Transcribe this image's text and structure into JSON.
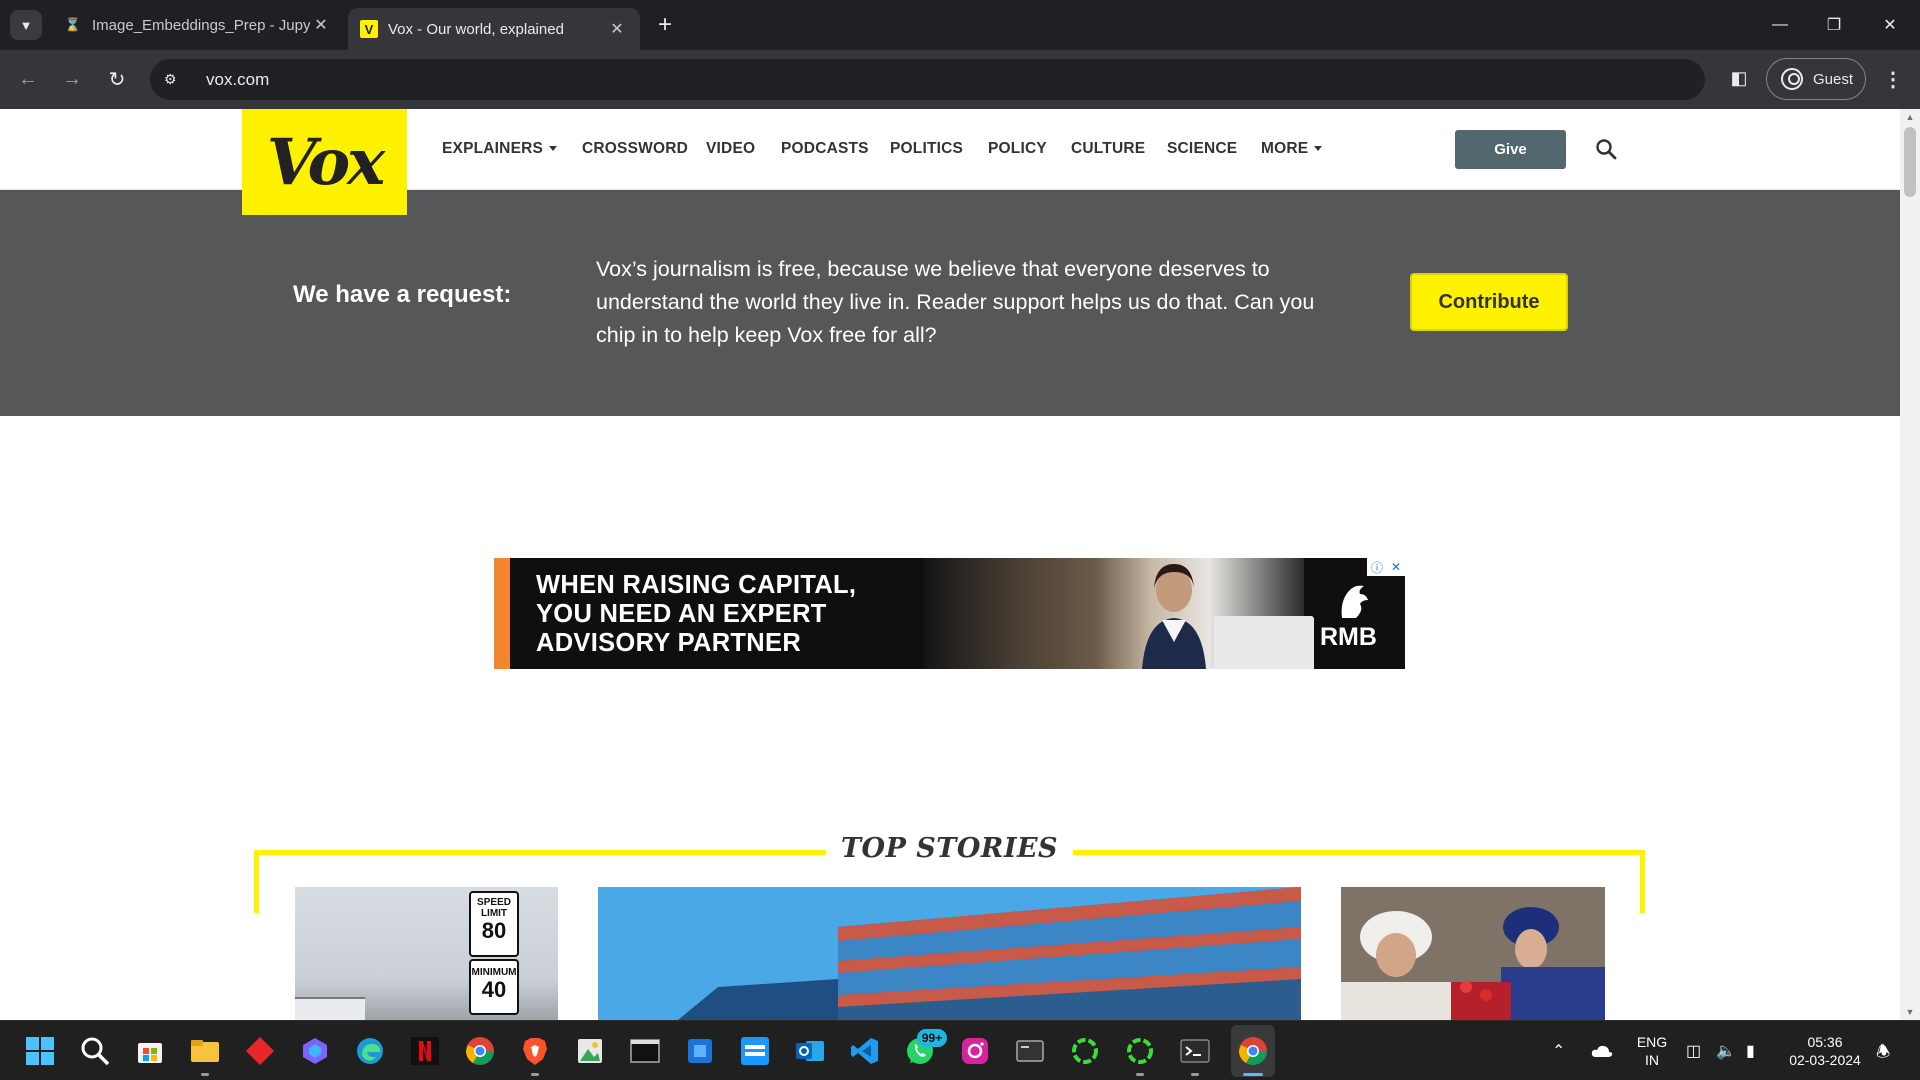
{
  "browser": {
    "tabs": [
      {
        "title": "Image_Embeddings_Prep - Jupyter",
        "favicon": "hourglass-icon"
      },
      {
        "title": "Vox - Our world, explained",
        "favicon": "vox-favicon",
        "active": true
      }
    ],
    "favicon_vox_letter": "V",
    "url": "vox.com",
    "profile_label": "Guest"
  },
  "vox": {
    "logo": "Vox",
    "nav": [
      "EXPLAINERS",
      "CROSSWORD",
      "VIDEO",
      "PODCASTS",
      "POLITICS",
      "POLICY",
      "CULTURE",
      "SCIENCE",
      "MORE"
    ],
    "give_label": "Give",
    "request_heading": "We have a request:",
    "request_body": "Vox’s journalism is free, because we believe that everyone deserves to understand the world they live in. Reader support helps us do that. Can you chip in to help keep Vox free for all?",
    "contribute_label": "Contribute",
    "top_stories_title": "TOP STORIES"
  },
  "ad": {
    "headline_line1": "WHEN RAISING CAPITAL,",
    "headline_line2": "YOU NEED AN EXPERT",
    "headline_line3": "ADVISORY PARTNER",
    "brand": "RMB"
  },
  "stories": {
    "sign_speed_top": "SPEED",
    "sign_speed_mid": "LIMIT",
    "sign_speed_value": "80",
    "sign_min_label": "MINIMUM",
    "sign_min_value": "40"
  },
  "taskbar": {
    "whatsapp_badge": "99+",
    "lang_line1": "ENG",
    "lang_line2": "IN",
    "time": "05:36",
    "date": "02-03-2024"
  },
  "colors": {
    "vox_yellow": "#fff200",
    "banner_gray": "#555758",
    "give_button": "#52686e",
    "ad_accent": "#f2862f"
  }
}
